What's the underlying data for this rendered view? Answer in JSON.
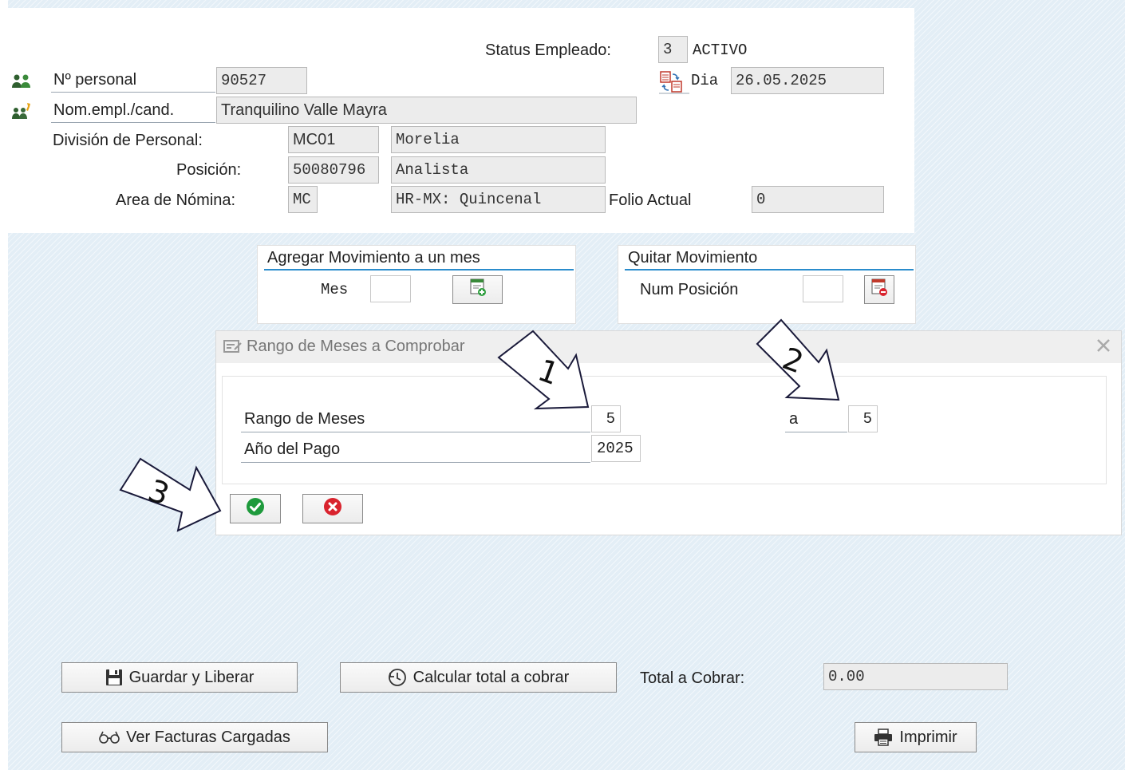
{
  "header": {
    "status_label": "Status Empleado:",
    "status_code": "3",
    "status_text": "ACTIVO",
    "personal_label": "Nº personal",
    "personal_value": "90527",
    "dia_label": "Dia",
    "dia_value": "26.05.2025",
    "nombre_label": "Nom.empl./cand.",
    "nombre_value": "Tranquilino Valle Mayra",
    "division_label": "División de Personal:",
    "division_code": "MC01",
    "division_text": "Morelia",
    "posicion_label": "Posición:",
    "posicion_code": "50080796",
    "posicion_text": "Analista",
    "area_label": "Area de Nómina:",
    "area_code": "MC",
    "area_text": "HR-MX: Quincenal",
    "folio_label": "Folio Actual",
    "folio_value": "0"
  },
  "agregar": {
    "title": "Agregar Movimiento a un mes",
    "mes_label": "Mes",
    "mes_value": ""
  },
  "quitar": {
    "title": "Quitar Movimiento",
    "num_label": "Num Posición",
    "num_value": ""
  },
  "dialog": {
    "title": "Rango de Meses a Comprobar",
    "rango_label": "Rango de Meses",
    "rango_from": "5",
    "a_label": "a",
    "rango_to": "5",
    "anio_label": "Año del Pago",
    "anio_value": "2025"
  },
  "annotations": [
    "1",
    "2",
    "3"
  ],
  "footer": {
    "guardar_label": "Guardar y Liberar",
    "calcular_label": "Calcular total a cobrar",
    "total_label": "Total a Cobrar:",
    "total_value": "0.00",
    "facturas_label": "Ver Facturas Cargadas",
    "imprimir_label": "Imprimir"
  },
  "colors": {
    "accent": "#2a8ccc",
    "confirm": "#1e9a3c",
    "cancel": "#d9232e"
  },
  "icons": [
    "employees-icon",
    "candidate-icon",
    "calendar-switch-icon",
    "add-document-icon",
    "remove-document-icon",
    "dialog-title-icon",
    "close-icon",
    "check-icon",
    "cancel-icon",
    "save-icon",
    "calculate-icon",
    "glasses-icon",
    "printer-icon"
  ]
}
